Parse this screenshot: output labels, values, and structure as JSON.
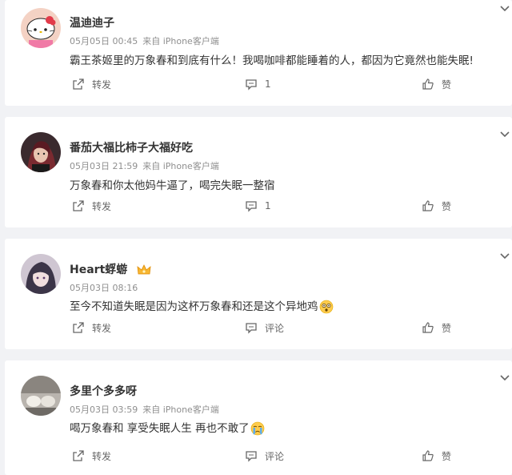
{
  "comments": [
    {
      "username": "温迪迪子",
      "date": "05月05日 00:45",
      "source": "来自 iPhone客户端",
      "text": "霸王茶姬里的万象春和到底有什么！我喝咖啡都能睡着的人，都因为它竟然也能失眠!",
      "share_label": "转发",
      "comment_label": "1",
      "like_label": "赞",
      "avatar_icon": "hello-kitty-avatar",
      "emoji_icon": ""
    },
    {
      "username": "番茄大福比柿子大福好吃",
      "date": "05月03日 21:59",
      "source": "来自 iPhone客户端",
      "text": "万象春和你太他妈牛逼了，喝完失眠一整宿",
      "share_label": "转发",
      "comment_label": "1",
      "like_label": "赞",
      "avatar_icon": "anime-character-avatar",
      "emoji_icon": ""
    },
    {
      "username": "Heart蜉蝣",
      "date": "05月03日 08:16",
      "source": "",
      "text": "至今不知道失眠是因为这杯万象春和还是这个异地鸡",
      "share_label": "转发",
      "comment_label": "评论",
      "like_label": "赞",
      "avatar_icon": "anime-girl-avatar",
      "emoji_icon": "dizzy-face-emoji",
      "badge_icon": "crown-vip-icon"
    },
    {
      "username": "多里个多多呀",
      "date": "05月03日 03:59",
      "source": "来自 iPhone客户端",
      "text": "喝万象春和 享受失眠人生 再也不敢了",
      "share_label": "转发",
      "comment_label": "评论",
      "like_label": "赞",
      "avatar_icon": "photo-avatar",
      "emoji_icon": "crying-face-emoji"
    }
  ],
  "colors": {
    "background": "#f1f2f5",
    "card": "#ffffff",
    "username": "#333333",
    "meta": "#8f8f8f",
    "action": "#666666"
  }
}
